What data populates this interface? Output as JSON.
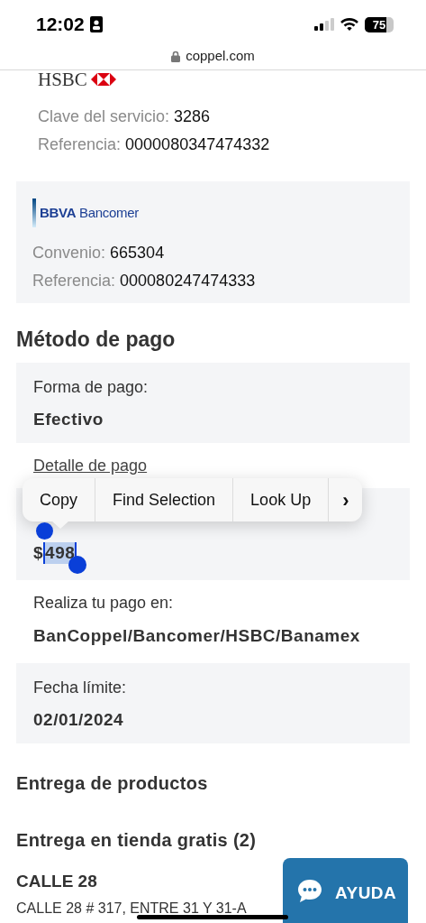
{
  "status_bar": {
    "time": "12:02",
    "battery": "75"
  },
  "address_bar": {
    "url": "coppel.com"
  },
  "banks": [
    {
      "kind": "hsbc",
      "logo": "HSBC",
      "boxed": false,
      "fields": [
        {
          "label": "Clave del servicio:",
          "value": "3286"
        },
        {
          "label": "Referencia:",
          "value": "0000080347474332"
        }
      ]
    },
    {
      "kind": "bbva",
      "logo": "BBVA",
      "logo_suffix": "Bancomer",
      "boxed": true,
      "fields": [
        {
          "label": "Convenio:",
          "value": "665304"
        },
        {
          "label": "Referencia:",
          "value": "000080247474333"
        }
      ]
    }
  ],
  "payment_method": {
    "title": "Método de pago",
    "items": [
      {
        "kind": "box",
        "label": "Forma de pago:",
        "value": "Efectivo"
      },
      {
        "kind": "link",
        "label": "Detalle de pago"
      },
      {
        "kind": "total",
        "currency": "$",
        "value": "498"
      },
      {
        "kind": "plain",
        "label": "Realiza tu pago en:",
        "value": "BanCoppel/Bancomer/HSBC/Banamex"
      },
      {
        "kind": "box",
        "label": "Fecha límite:",
        "value": "02/01/2024"
      }
    ]
  },
  "delivery": {
    "title": "Entrega de productos",
    "subtitle": "Entrega en tienda gratis (2)",
    "store": "CALLE 28",
    "address": "CALLE 28 # 317, ENTRE 31 Y 31-A"
  },
  "context_menu": {
    "items": [
      "Copy",
      "Find Selection",
      "Look Up"
    ],
    "more": "›"
  },
  "help_button": {
    "label": "AYUDA"
  }
}
